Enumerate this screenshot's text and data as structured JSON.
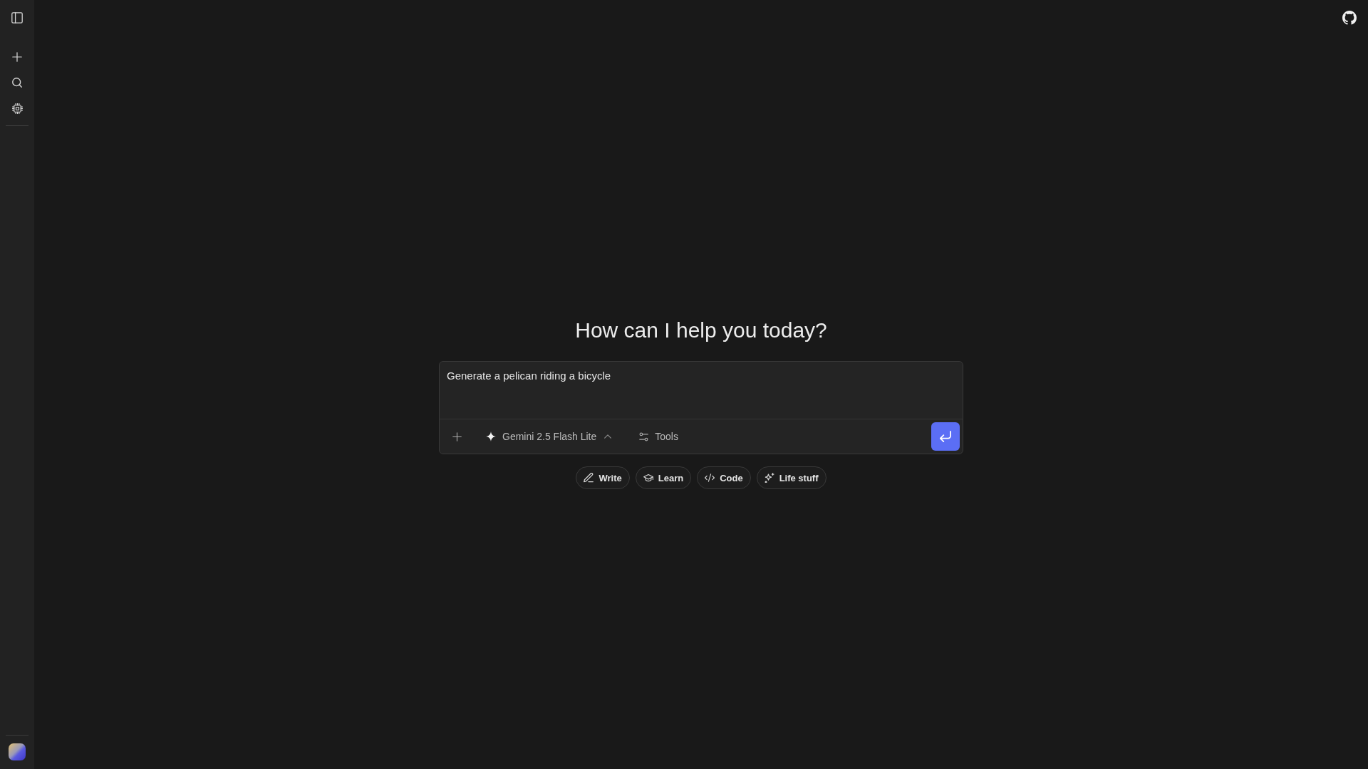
{
  "heading": "How can I help you today?",
  "composer": {
    "value": "Generate a pelican riding a bicycle",
    "model": "Gemini 2.5 Flash Lite",
    "tools_label": "Tools"
  },
  "suggestions": [
    {
      "label": "Write"
    },
    {
      "label": "Learn"
    },
    {
      "label": "Code"
    },
    {
      "label": "Life stuff"
    }
  ]
}
